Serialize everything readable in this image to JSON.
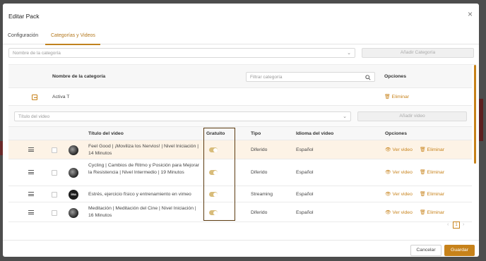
{
  "modal": {
    "title": "Editar Pack",
    "close_label": "×",
    "tabs": [
      {
        "label": "Configuración",
        "active": false
      },
      {
        "label": "Categorías y Videos",
        "active": true
      }
    ]
  },
  "category_picker": {
    "placeholder": "Nombre de la categoría",
    "add_button": "Añadir Categoría"
  },
  "category_table": {
    "col_name": "Nombre de la categoría",
    "filter_placeholder": "Filtrar categoría",
    "col_options": "Opciones",
    "rows": [
      {
        "name": "Activa T",
        "action": "Eliminar"
      }
    ]
  },
  "video_picker": {
    "placeholder": "Título del video",
    "add_button": "Añadir video"
  },
  "video_table": {
    "headers": {
      "title": "Título del video",
      "free": "Gratuito",
      "type": "Tipo",
      "language": "Idioma del video",
      "options": "Opciones"
    },
    "rows": [
      {
        "title": "Feel Good | ¡Moviliza los Nervios! | Nivel Iniciación | 14 Minutos",
        "free": true,
        "type": "Diferido",
        "language": "Español",
        "view": "Ver video",
        "delete": "Eliminar",
        "thumb": "photo"
      },
      {
        "title": "Cycling | Cambios de Ritmo y Posición para Mejorar la Resistencia | Nivel Intermedio | 19 Minutos",
        "free": true,
        "type": "Diferido",
        "language": "Español",
        "view": "Ver video",
        "delete": "Eliminar",
        "thumb": "photo"
      },
      {
        "title": "Estrés, ejercicio físico y entrenamiento en vimeo",
        "free": true,
        "type": "Streaming",
        "language": "Español",
        "view": "Ver video",
        "delete": "Eliminar",
        "thumb": "logo",
        "thumb_text": "ima"
      },
      {
        "title": "Meditación | Meditación del Cine | Nivel Iniciación | 16 Minutos",
        "free": true,
        "type": "Diferido",
        "language": "Español",
        "view": "Ver video",
        "delete": "Eliminar",
        "thumb": "photo"
      }
    ]
  },
  "pagination": {
    "current": "1",
    "prev": "‹",
    "next": "›"
  },
  "footer": {
    "cancel": "Cancelar",
    "save": "Guardar"
  },
  "colors": {
    "accent": "#c7821a",
    "highlight_row": "#fdf3e6",
    "highlight_box": "#5b3a10"
  }
}
